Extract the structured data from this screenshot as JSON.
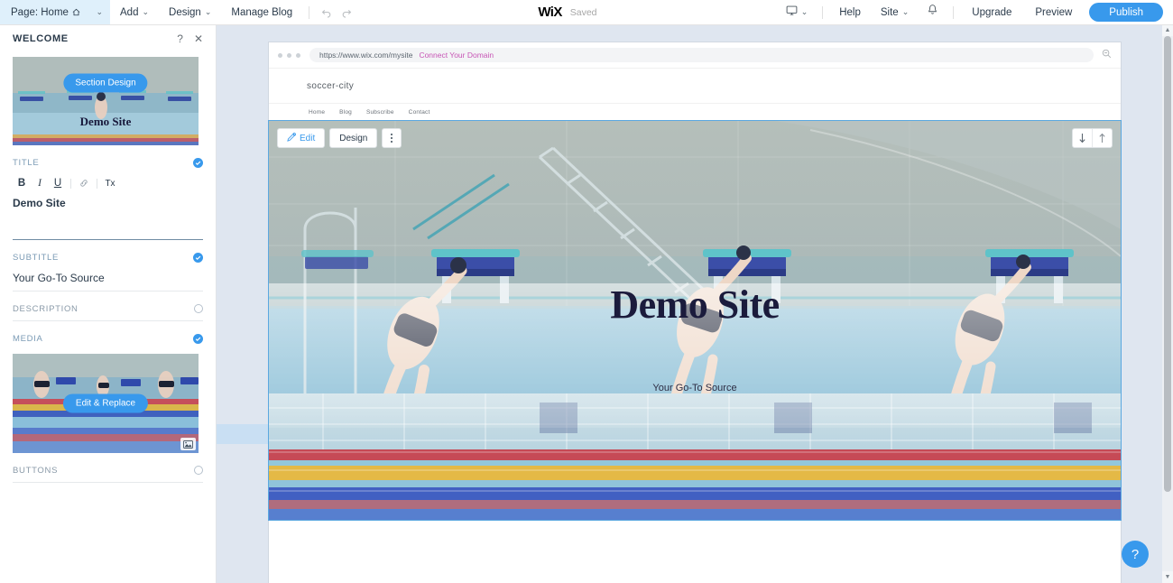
{
  "topbar": {
    "page_selector": {
      "label": "Page: Home",
      "icon": "home-icon",
      "caret": "⌄"
    },
    "menus": [
      {
        "label": "Add",
        "caret": "⌄"
      },
      {
        "label": "Design",
        "caret": "⌄"
      },
      {
        "label": "Manage Blog",
        "caret": ""
      }
    ],
    "undo_label": "Undo",
    "redo_label": "Redo",
    "logo": "WiX",
    "save_status": "Saved",
    "device_icon": "monitor-icon",
    "device_caret": "⌄",
    "help_label": "Help",
    "site_label": "Site",
    "site_caret": "⌄",
    "notifications_icon": "bell-icon",
    "upgrade_label": "Upgrade",
    "preview_label": "Preview",
    "publish_label": "Publish",
    "accent_color": "#3899ec"
  },
  "panel": {
    "title": "WELCOME",
    "help_icon": "?",
    "close_icon": "✕",
    "preview_thumb": {
      "button_label": "Section Design",
      "overlay_title": "Demo Site"
    },
    "sections": [
      {
        "label": "TITLE",
        "enabled": true,
        "value": "Demo Site",
        "format_buttons": [
          "B",
          "I",
          "U",
          "link-icon",
          "Tx"
        ]
      },
      {
        "label": "SUBTITLE",
        "enabled": true,
        "value": "Your Go-To Source"
      },
      {
        "label": "DESCRIPTION",
        "enabled": false,
        "value": ""
      },
      {
        "label": "MEDIA",
        "enabled": true,
        "media_button_label": "Edit & Replace",
        "media_badge_icon": "image-icon"
      },
      {
        "label": "BUTTONS",
        "enabled": false,
        "value": ""
      }
    ]
  },
  "canvas": {
    "browser": {
      "url": "https://www.wix.com/mysite",
      "connect_domain_label": "Connect Your Domain",
      "connect_domain_color": "#c755b5",
      "zoom_icon": "zoom-out-icon"
    },
    "site": {
      "name": "soccer-city",
      "nav": [
        "Home",
        "Blog",
        "Subscribe",
        "Contact"
      ],
      "hero": {
        "title": "Demo Site",
        "subtitle": "Your Go-To Source",
        "title_color": "#1b1b3c"
      }
    },
    "section_toolbar": {
      "edit_label": "Edit",
      "edit_icon": "pencil-icon",
      "design_label": "Design",
      "more_icon": "kebab-menu-icon",
      "move_down_icon": "arrow-down-icon",
      "move_up_icon": "arrow-up-icon"
    },
    "help_fab_label": "?"
  },
  "scrollbar": {
    "up_icon": "▲",
    "down_icon": "▼"
  }
}
